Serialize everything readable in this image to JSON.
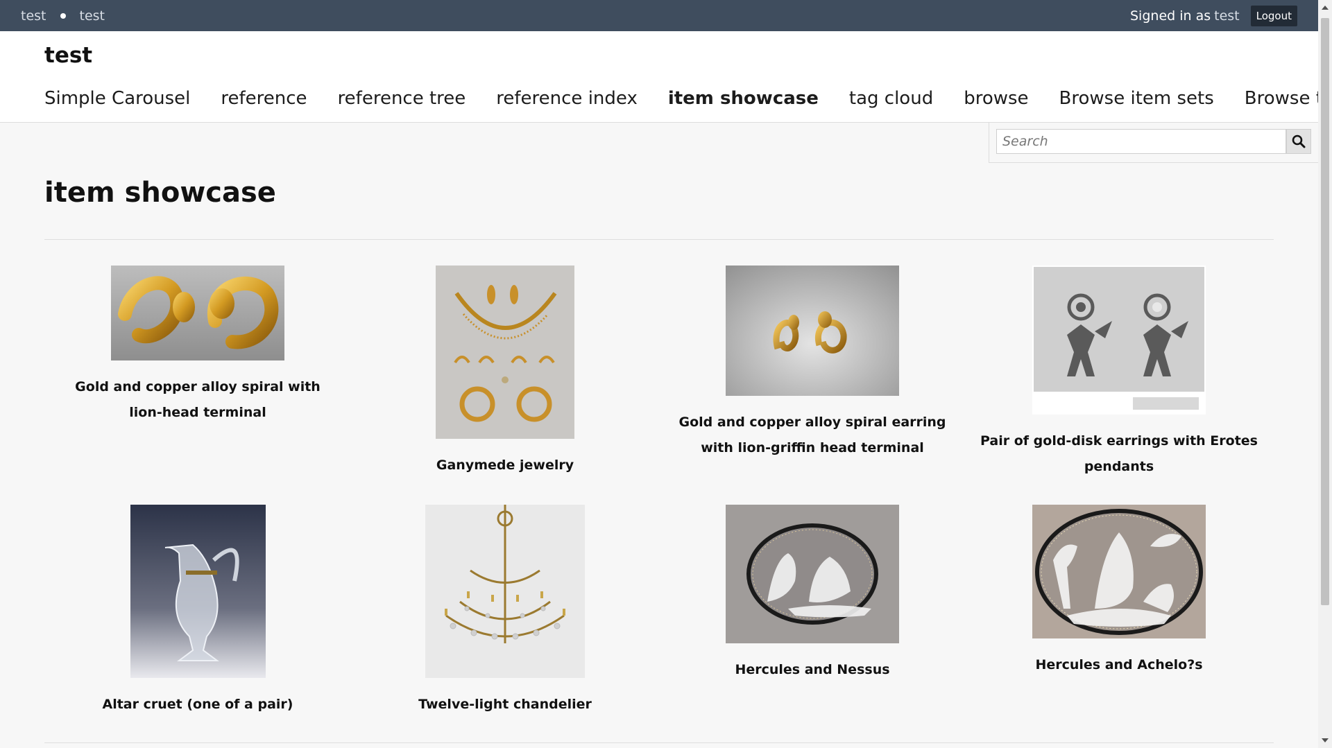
{
  "topbar": {
    "site_links": [
      "test",
      "test"
    ],
    "signed_in_label": "Signed in as",
    "user_name": "test",
    "logout_label": "Logout"
  },
  "header": {
    "site_title": "test",
    "nav": [
      {
        "label": "Simple Carousel"
      },
      {
        "label": "reference"
      },
      {
        "label": "reference tree"
      },
      {
        "label": "reference index"
      },
      {
        "label": "item showcase",
        "active": true
      },
      {
        "label": "tag cloud"
      },
      {
        "label": "browse"
      },
      {
        "label": "Browse item sets"
      },
      {
        "label": "Browse tags"
      }
    ]
  },
  "search": {
    "placeholder": "Search",
    "value": "",
    "icon": "search-icon"
  },
  "page": {
    "title": "item showcase"
  },
  "items": [
    {
      "caption": "Gold and copper alloy spiral with lion-head terminal",
      "icon": "gold-spiral-image"
    },
    {
      "caption": "Ganymede jewelry",
      "icon": "jewelry-set-image"
    },
    {
      "caption": "Gold and copper alloy spiral earring with lion-griffin head terminal",
      "icon": "spiral-earrings-image"
    },
    {
      "caption": "Pair of gold-disk earrings with Erotes pendants",
      "icon": "erotes-earrings-image"
    },
    {
      "caption": "Altar cruet (one of a pair)",
      "icon": "glass-cruet-image"
    },
    {
      "caption": "Twelve-light chandelier",
      "icon": "chandelier-image"
    },
    {
      "caption": "Hercules and Nessus",
      "icon": "cameo-image"
    },
    {
      "caption": "Hercules and Achelo?s",
      "icon": "cameo-image"
    }
  ],
  "colors": {
    "topbar_bg": "#3f4d5e",
    "page_bg": "#f7f7f7",
    "header_bg": "#ffffff"
  }
}
